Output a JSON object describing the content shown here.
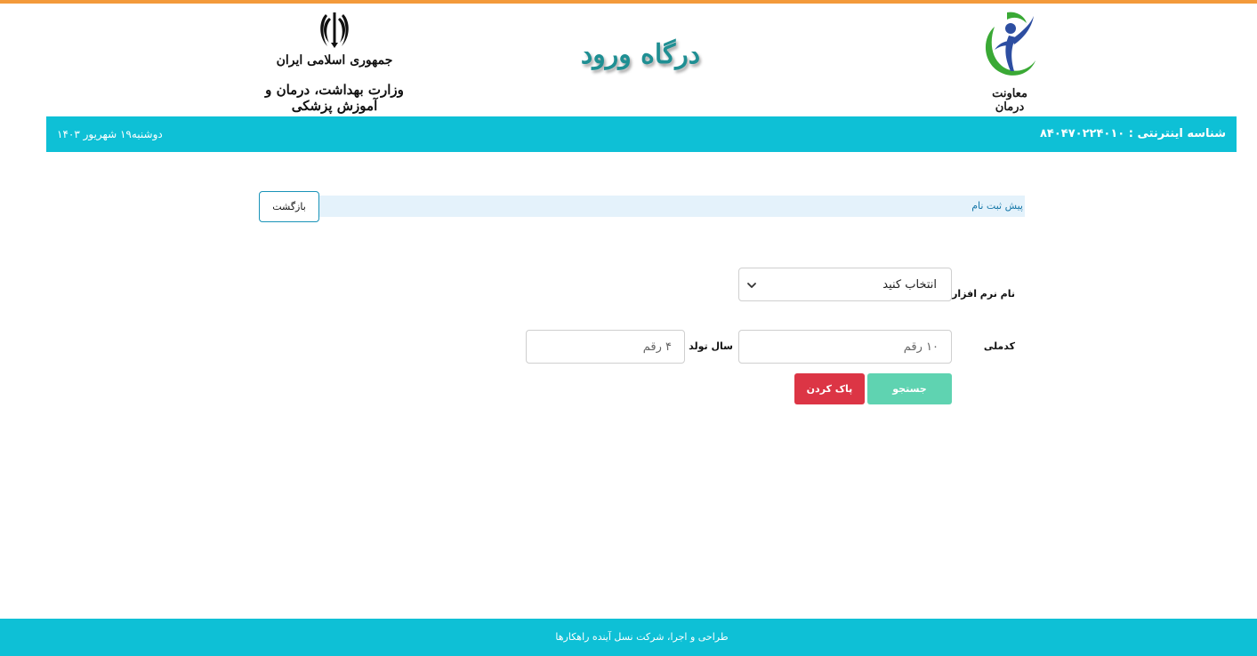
{
  "header": {
    "right_logo_caption": "معاونت درمان",
    "portal_title": "درگاه ورود",
    "ministry_line1": "جمهوری اسلامی ایران",
    "ministry_line2": "وزارت بهداشت، درمان و آموزش پزشکی"
  },
  "info_bar": {
    "identifier_text": "شناسه اینترنتی : ۸۴۰۴۷۰۲۲۴۰۱۰",
    "date_text": "دوشنبه۱۹ شهریور ۱۴۰۳"
  },
  "section": {
    "title": "پیش ثبت نام",
    "back_label": "بازگشت"
  },
  "form": {
    "software_label": "نام نرم افزار",
    "software_selected": "انتخاب کنید",
    "national_id_label": "کدملی",
    "national_id_placeholder": "۱۰ رقم",
    "birth_year_label": "سال تولد",
    "birth_year_placeholder": "۴ رقم",
    "search_label": "جستجو",
    "clear_label": "پاک کردن"
  },
  "footer": {
    "text": "طراحی و اجرا، شرکت نسل آینده راهکارها"
  },
  "colors": {
    "accent_bar": "#0ec0d6",
    "top_stripe": "#f39a3b",
    "title_teal": "#1f8f93",
    "search_button": "#5fd3b1",
    "clear_button": "#dc3545"
  },
  "icons": {
    "select_arrow": "chevron-down-icon",
    "ministry_emblem": "iran-emblem-icon",
    "treatment_logo": "treatment-deputy-logo-icon"
  }
}
